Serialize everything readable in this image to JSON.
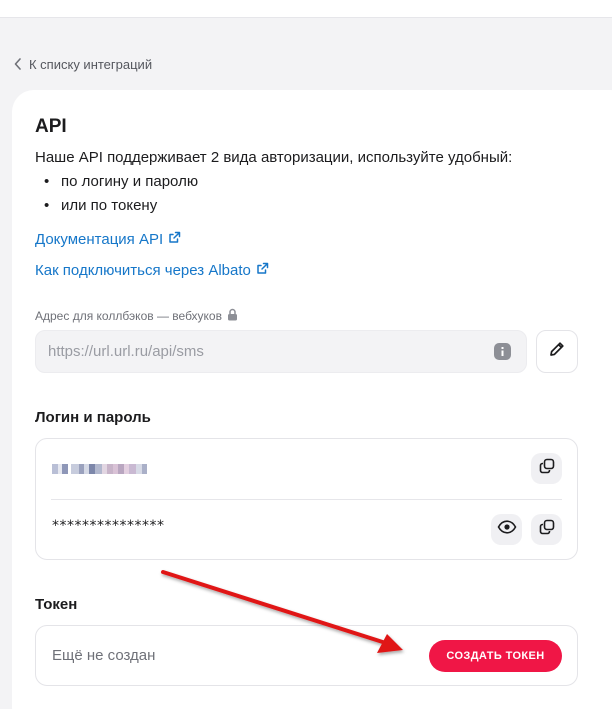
{
  "back_link": {
    "label": "К списку интеграций",
    "icon": "chevron-left-icon"
  },
  "api": {
    "title": "API",
    "description": "Наше API поддерживает 2 вида авторизации, используйте удобный:",
    "bullets": [
      "по логину и паролю",
      "или по токену"
    ],
    "bullet_char": "•",
    "docs_link": "Документация API",
    "connect_link": "Как подключиться через Albato",
    "link_icon": "external-link-icon"
  },
  "callback": {
    "label": "Адрес для коллбэков — вебхуков",
    "label_icon": "lock-icon",
    "placeholder": "https://url.url.ru/api/sms",
    "info_icon": "info-icon",
    "edit_icon": "pencil-icon"
  },
  "credentials": {
    "title": "Логин и пароль",
    "login_masked": true,
    "password": "***************",
    "copy_icon": "copy-icon",
    "show_icon": "eye-icon"
  },
  "token": {
    "title": "Токен",
    "status": "Ещё не создан",
    "create_button": "СОЗДАТЬ ТОКЕН"
  },
  "colors": {
    "accent_link": "#1677c9",
    "primary_button": "#f01646",
    "annotation_arrow": "#e01818",
    "page_background": "#f3f3f5"
  }
}
